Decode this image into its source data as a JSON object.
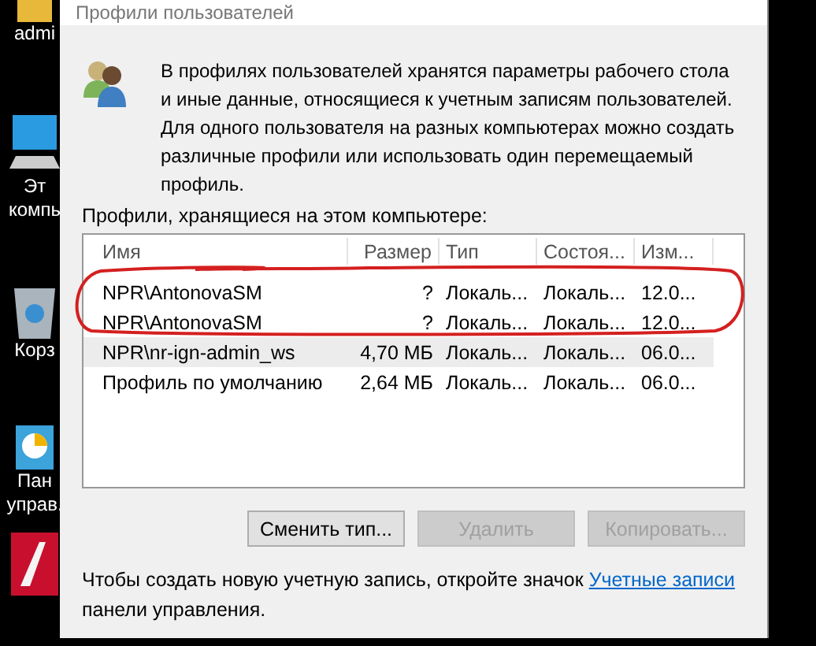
{
  "desktop": {
    "icons": [
      {
        "kind": "folder",
        "labels": [
          "admi"
        ]
      },
      {
        "kind": "computer",
        "labels": [
          "Эт",
          "компь"
        ]
      },
      {
        "kind": "bin",
        "labels": [
          "Корз"
        ]
      },
      {
        "kind": "panel",
        "labels": [
          "Пан",
          "управ."
        ]
      },
      {
        "kind": "app"
      }
    ]
  },
  "window": {
    "title": "Профили пользователей"
  },
  "intro": "В профилях пользователей хранятся параметры рабочего стола и иные данные, относящиеся к учетным записям пользователей. Для одного пользователя на разных компьютерах можно создать различные профили или использовать один перемещаемый профиль.",
  "list_label": "Профили, хранящиеся на этом компьютере:",
  "table": {
    "columns": [
      "Имя",
      "Размер",
      "Тип",
      "Состоя...",
      "Изм..."
    ],
    "rows": [
      {
        "cells": [
          "NPR\\AntonovaSM",
          "?",
          "Локаль...",
          "Локаль...",
          "12.0..."
        ],
        "selected": false
      },
      {
        "cells": [
          "NPR\\AntonovaSM",
          "?",
          "Локаль...",
          "Локаль...",
          "12.0..."
        ],
        "selected": false
      },
      {
        "cells": [
          "NPR\\nr-ign-admin_ws",
          "4,70 МБ",
          "Локаль...",
          "Локаль...",
          "06.0..."
        ],
        "selected": true
      },
      {
        "cells": [
          "Профиль по умолчанию",
          "2,64 МБ",
          "Локаль...",
          "Локаль...",
          "06.0..."
        ],
        "selected": false
      }
    ]
  },
  "buttons": [
    {
      "label": "Сменить тип...",
      "disabled": false
    },
    {
      "label": "Удалить",
      "disabled": true
    },
    {
      "label": "Копировать...",
      "disabled": true
    }
  ],
  "footer": {
    "text": "Чтобы создать новую учетную запись, откройте значок",
    "link": "Учетные записи",
    "text_after": "панели управления."
  }
}
